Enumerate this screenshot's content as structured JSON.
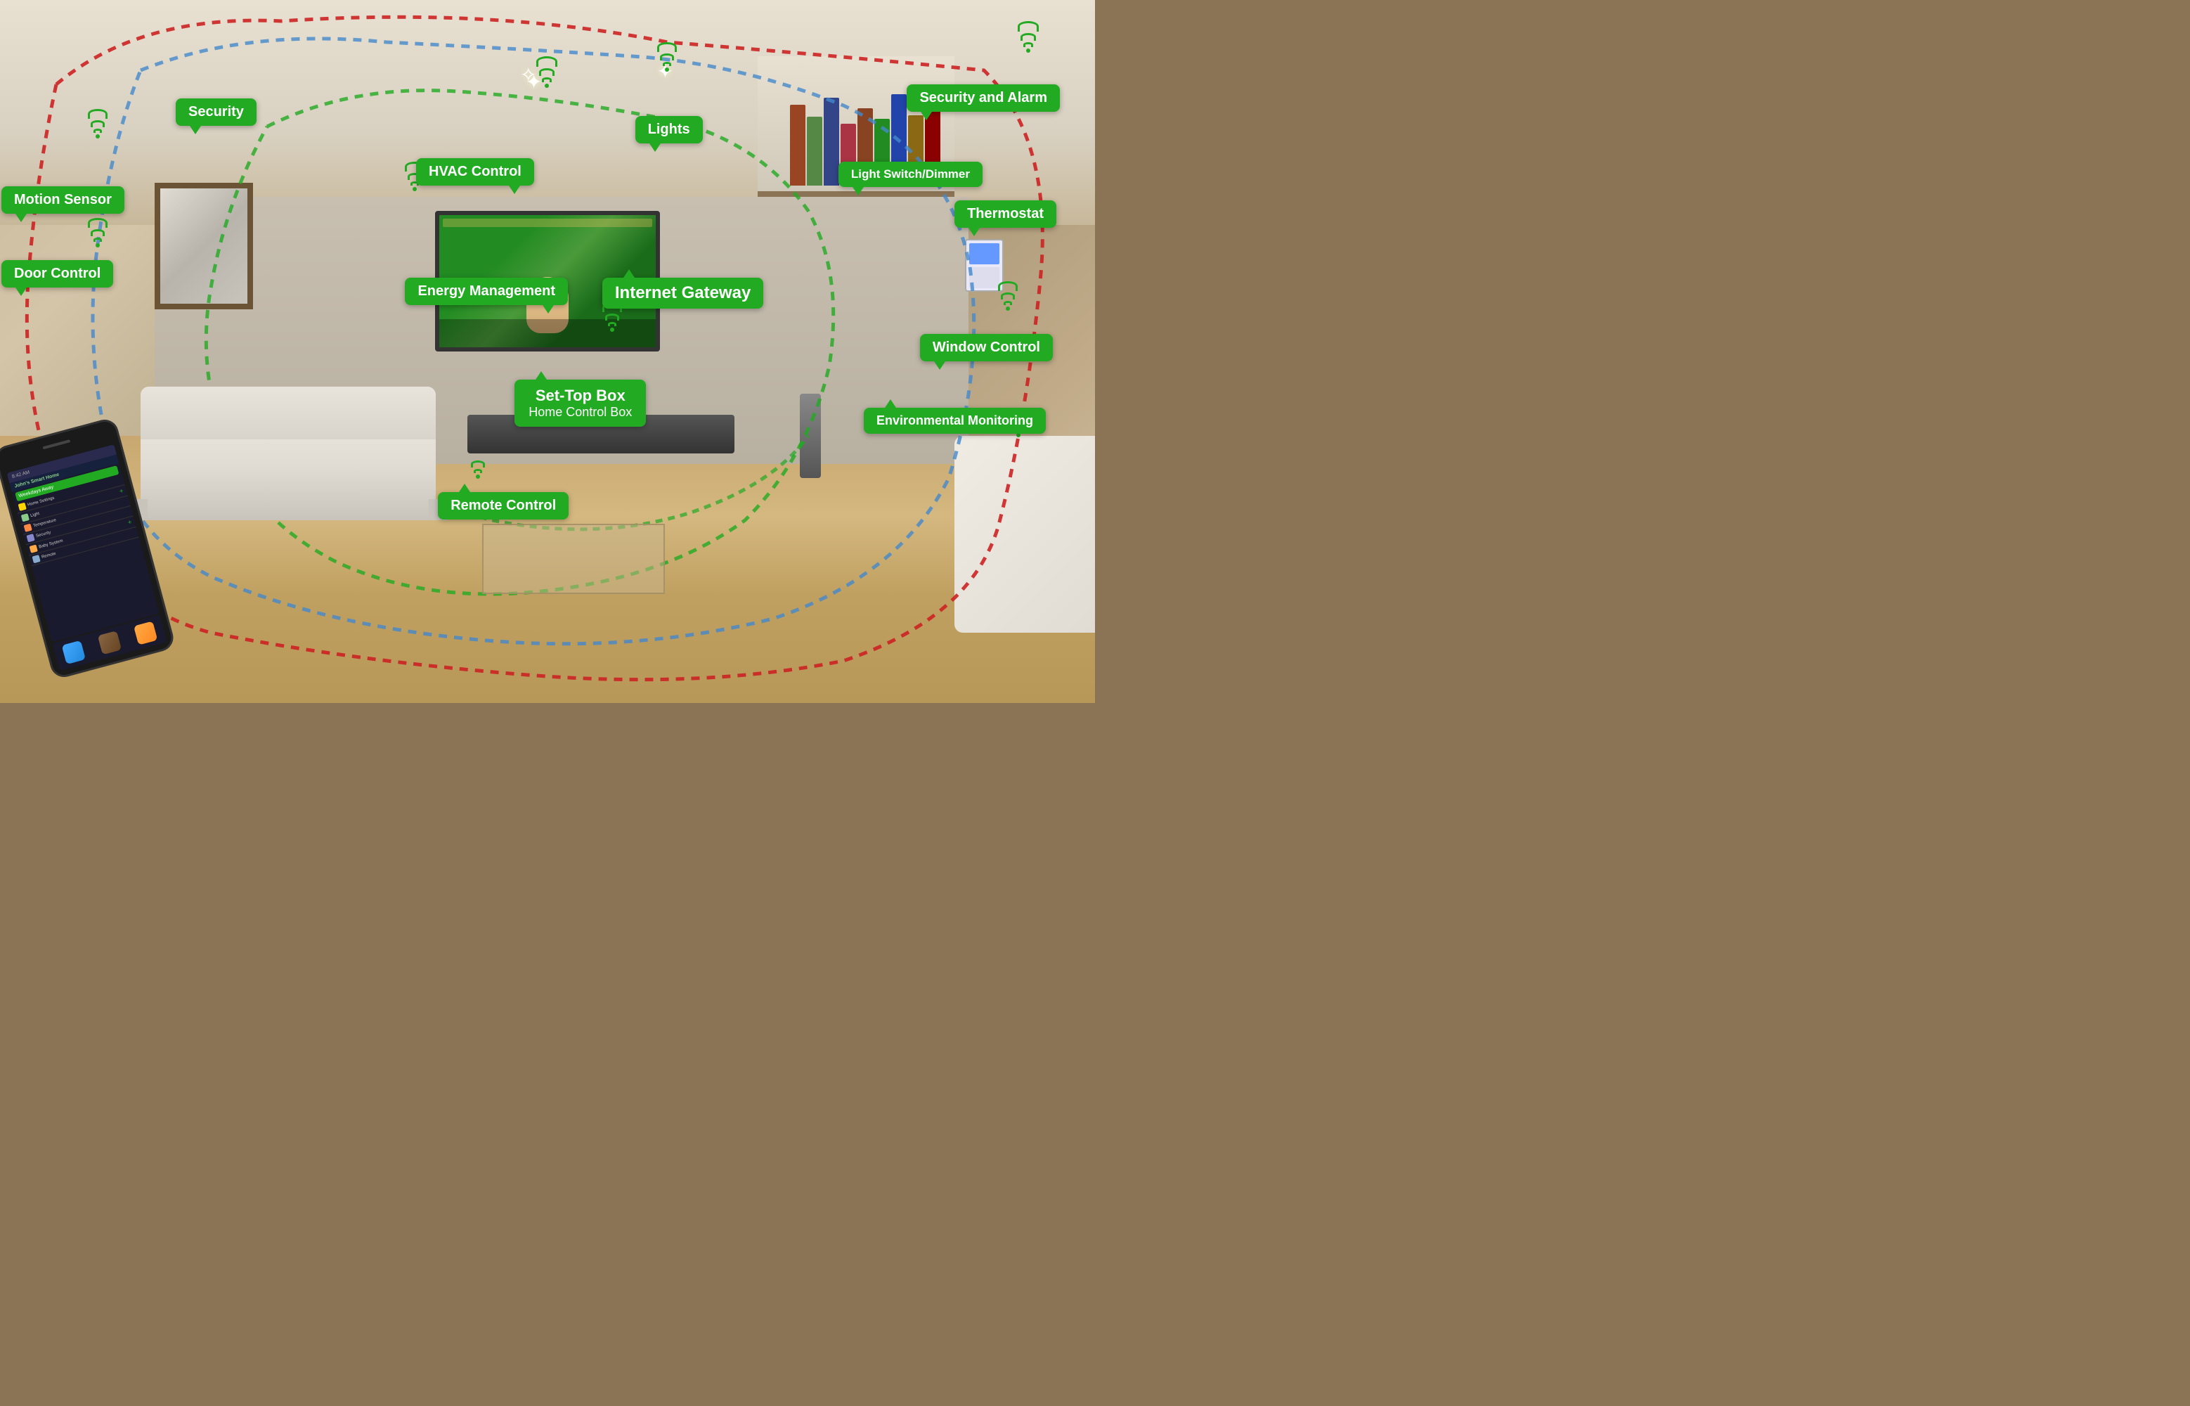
{
  "labels": {
    "security": "Security",
    "motion_sensor": "Motion Sensor",
    "door_control": "Door Control",
    "hvac_control": "HVAC Control",
    "energy_management": "Energy Management",
    "lights": "Lights",
    "light_switch_dimmer": "Light Switch/Dimmer",
    "security_and_alarm": "Security and Alarm",
    "thermostat": "Thermostat",
    "internet_gateway": "Internet Gateway",
    "window_control": "Window Control",
    "set_top_box_line1": "Set-Top Box",
    "set_top_box_line2": "Home Control Box",
    "environmental_monitoring": "Environmental Monitoring",
    "remote_control": "Remote Control"
  },
  "phone": {
    "time": "8:42 AM",
    "app_name": "John's Smart Home",
    "active_item": "Weekdays Away",
    "menu_items": [
      {
        "icon_color": "#FFD700",
        "label": "Home Settings"
      },
      {
        "icon_color": "#88CC88",
        "label": "Light"
      },
      {
        "icon_color": "#FF8844",
        "label": "Temperature"
      },
      {
        "icon_color": "#8888CC",
        "label": "Security"
      },
      {
        "icon_color": "#FFAA44",
        "label": "Baby System"
      },
      {
        "icon_color": "#88AACC",
        "label": "Remote"
      }
    ]
  },
  "colors": {
    "label_bg": "#22aa22",
    "label_text": "#ffffff",
    "dot_red": "#cc2222",
    "dot_blue": "#4488cc",
    "dot_green": "#22aa22",
    "accent": "#22aa22"
  }
}
